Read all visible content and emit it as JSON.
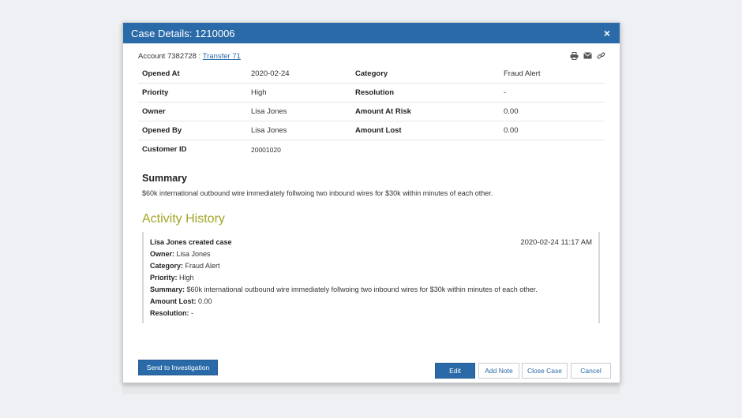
{
  "modal": {
    "title": "Case Details: 1210006",
    "close_label": "×"
  },
  "account": {
    "prefix": "Account 7382728 : ",
    "link": "Transfer 71"
  },
  "toolbar": {
    "icons": [
      "print-icon",
      "email-icon",
      "link-icon"
    ]
  },
  "details": {
    "rows": [
      {
        "l1": "Opened At",
        "v1": "2020-02-24",
        "l2": "Category",
        "v2": "Fraud Alert"
      },
      {
        "l1": "Priority",
        "v1": "High",
        "l2": "Resolution",
        "v2": "-"
      },
      {
        "l1": "Owner",
        "v1": "Lisa Jones",
        "l2": "Amount At Risk",
        "v2": "0.00"
      },
      {
        "l1": "Opened By",
        "v1": "Lisa Jones",
        "l2": "Amount Lost",
        "v2": "0.00"
      },
      {
        "l1": "Customer ID",
        "v1": "20001020",
        "l2": "",
        "v2": ""
      }
    ]
  },
  "summary": {
    "heading": "Summary",
    "text": "$60k international outbound wire immediately follwoing two inbound wires for $30k within minutes of each other."
  },
  "activity": {
    "heading": "Activity History",
    "entry": {
      "title": "Lisa Jones created case",
      "timestamp": "2020-02-24 11:17 AM",
      "owner_label": "Owner:",
      "owner": " Lisa Jones",
      "category_label": "Category:",
      "category": " Fraud Alert",
      "priority_label": "Priority:",
      "priority": " High",
      "summary_label": "Summary:",
      "summary": " $60k international outbound wire immediately follwoing two inbound wires for $30k within minutes of each other.",
      "amount_lost_label": "Amount Lost:",
      "amount_lost": " 0.00",
      "resolution_label": "Resolution:",
      "resolution": " -"
    }
  },
  "buttons": {
    "send_to_investigation": "Send to Investigation",
    "edit": "Edit",
    "add_note": "Add Note",
    "close_case": "Close Case",
    "cancel": "Cancel"
  },
  "colors": {
    "header": "#2b6aa8",
    "accent_heading": "#a3a327",
    "link": "#2b6aa8"
  }
}
